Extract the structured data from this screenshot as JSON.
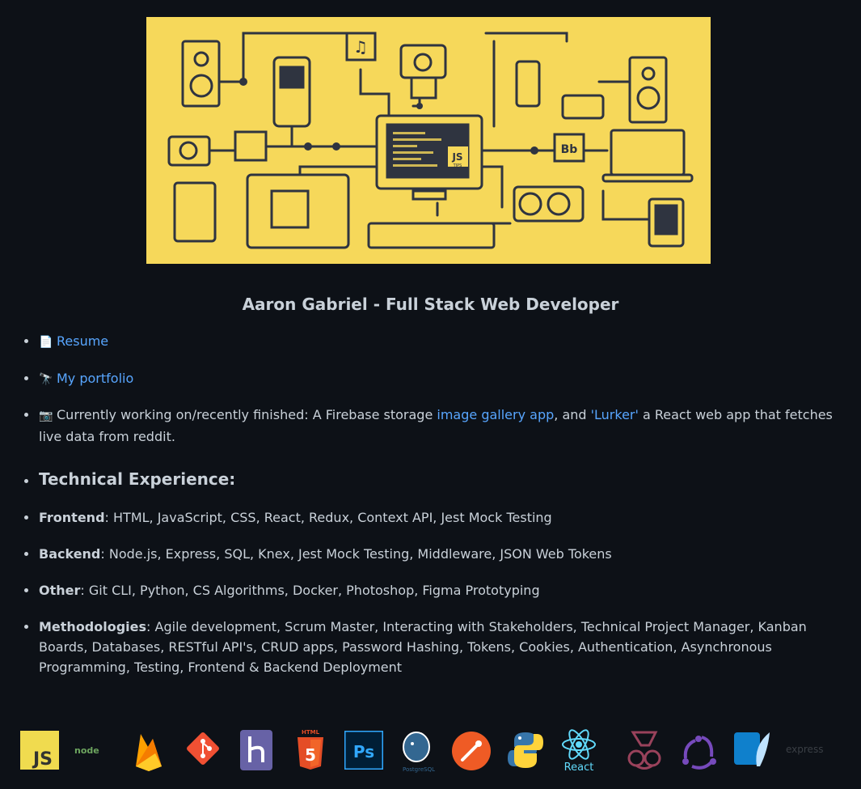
{
  "profile": {
    "title": "Aaron Gabriel - Full Stack Web Developer"
  },
  "banner": {
    "badge_js": "JS",
    "badge_js_sub": "TIPS",
    "badge_bb": "Bb"
  },
  "links": [
    {
      "emoji": "📄",
      "label": "Resume"
    },
    {
      "emoji": "🔭",
      "label": "My portfolio"
    }
  ],
  "current": {
    "emoji": "📷",
    "prefix": "Currently working on/recently finished: A Firebase storage ",
    "link1": "image gallery app",
    "middle": ", and ",
    "link2": "'Lurker'",
    "suffix": " a React web app that fetches live data from reddit."
  },
  "tech": {
    "heading": "Technical Experience:",
    "items": [
      {
        "label": "Frontend",
        "text": ": HTML, JavaScript, CSS, React, Redux, Context API, Jest Mock Testing"
      },
      {
        "label": "Backend",
        "text": ": Node.js, Express, SQL, Knex, Jest Mock Testing, Middleware, JSON Web Tokens"
      },
      {
        "label": "Other",
        "text": ": Git CLI, Python, CS Algorithms, Docker, Photoshop, Figma Prototyping"
      },
      {
        "label": "Methodologies",
        "text": ": Agile development, Scrum Master, Interacting with Stakeholders, Technical Project Manager, Kanban Boards, Databases, RESTful API's, CRUD apps, Password Hashing, Tokens, Cookies, Authentication, Asynchronous Programming, Testing, Frontend & Backend Deployment"
      }
    ]
  },
  "icons": {
    "js": "JS",
    "node": "node",
    "html": "HTML",
    "ps": "Ps",
    "postgres": "PostgreSQL",
    "react": "React",
    "express": "express"
  },
  "colors": {
    "background": "#0d1117",
    "text": "#c9d1d9",
    "link": "#58a6ff",
    "banner": "#f6d85a"
  }
}
